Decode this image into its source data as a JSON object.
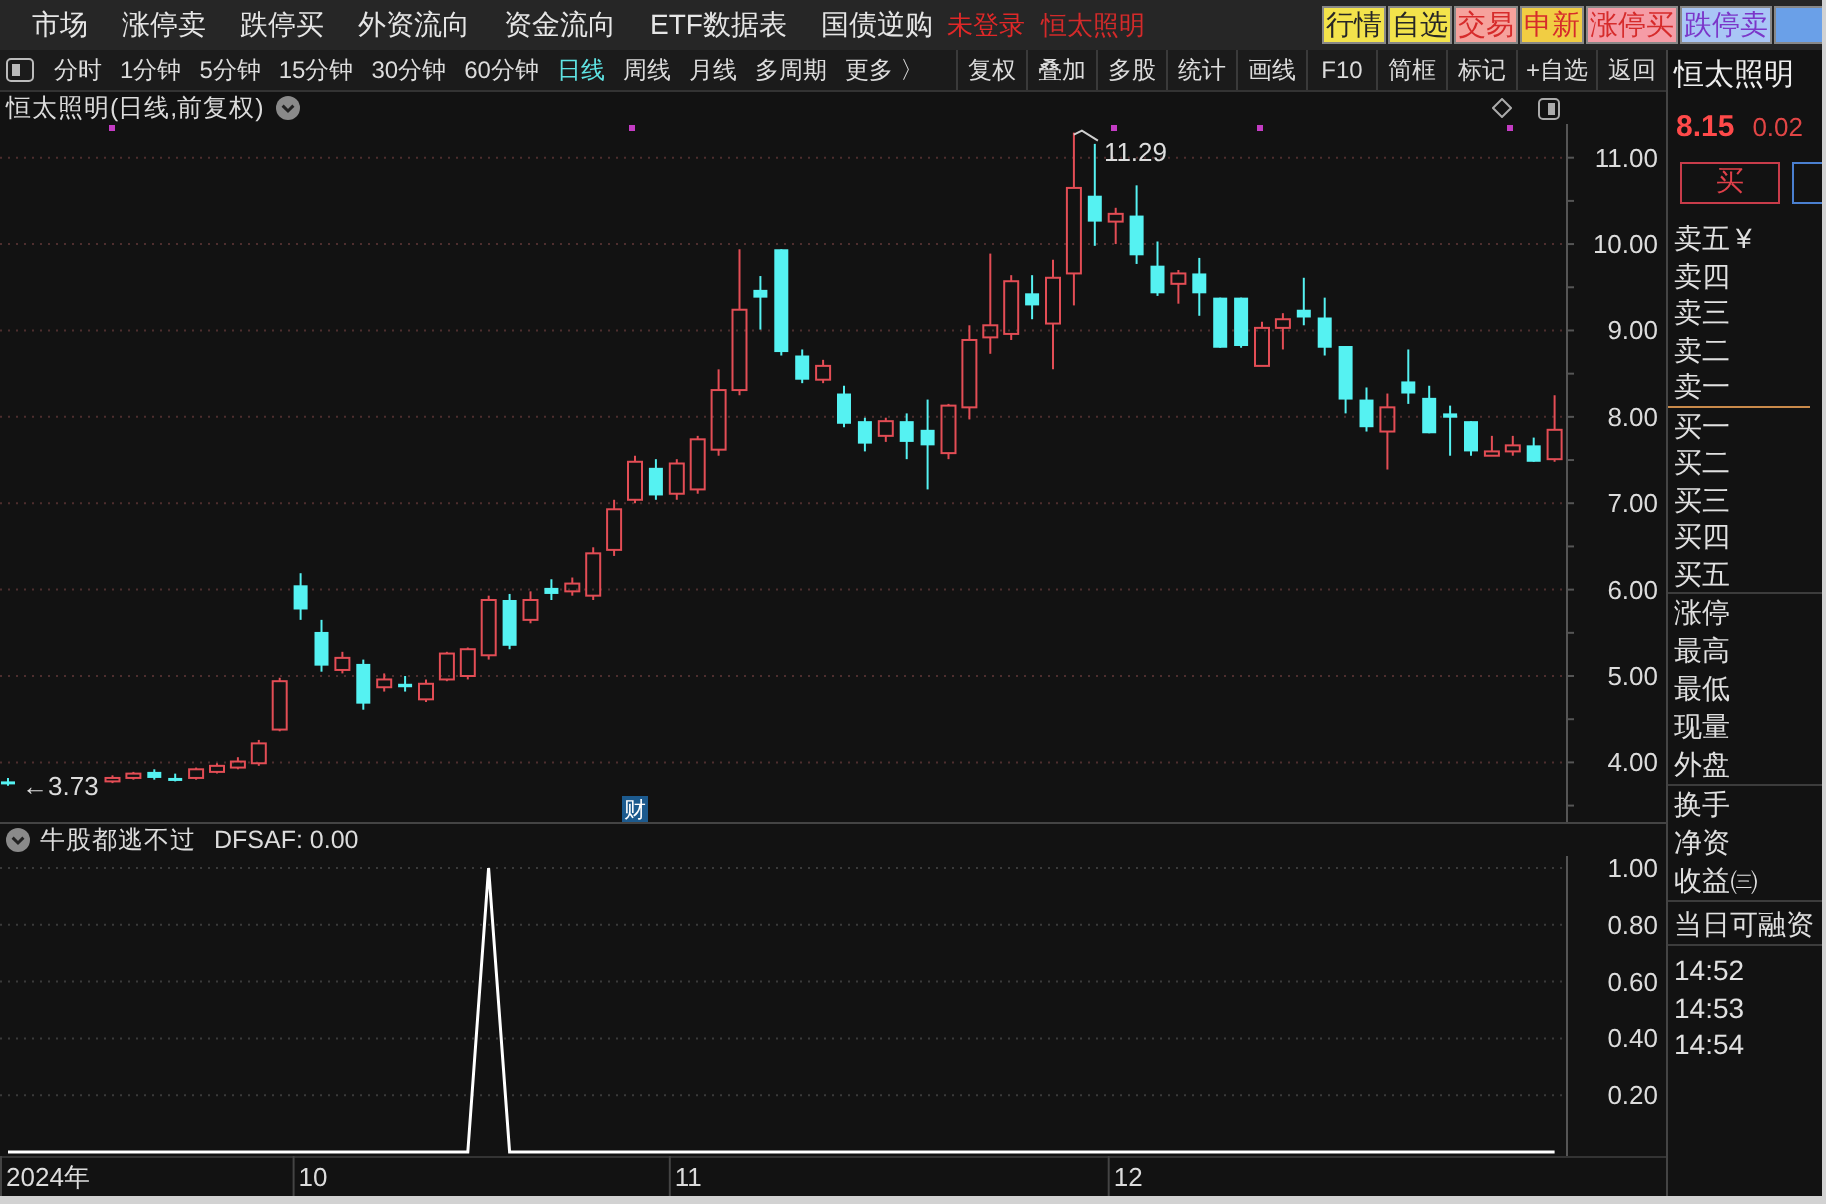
{
  "menu": [
    "市场",
    "涨停卖",
    "跌停买",
    "外资流向",
    "资金流向",
    "ETF数据表",
    "国债逆购"
  ],
  "login_status": "未登录",
  "current_stock": "恒太照明",
  "quick_buttons": [
    {
      "label": "行情",
      "color": "#f3e34b",
      "kind": "quote"
    },
    {
      "label": "自选",
      "color": "#f3e34b",
      "kind": "quote"
    },
    {
      "label": "交易",
      "color": "#f6a29c",
      "kind": "trade"
    },
    {
      "label": "申新",
      "color": "#f1cd43",
      "kind": "trade"
    },
    {
      "label": "涨停买",
      "color": "#f59ca6",
      "kind": "trade"
    },
    {
      "label": "跌停卖",
      "color": "#a9c6f6",
      "kind": "fall"
    },
    {
      "color": "#6aa0e8"
    }
  ],
  "periods": [
    {
      "label": "分时",
      "selected": false
    },
    {
      "label": "1分钟",
      "selected": false
    },
    {
      "label": "5分钟",
      "selected": false
    },
    {
      "label": "15分钟",
      "selected": false
    },
    {
      "label": "30分钟",
      "selected": false
    },
    {
      "label": "60分钟",
      "selected": false
    },
    {
      "label": "日线",
      "selected": true
    },
    {
      "label": "周线",
      "selected": false
    },
    {
      "label": "月线",
      "selected": false
    },
    {
      "label": "多周期",
      "selected": false
    },
    {
      "label": "更多 〉",
      "selected": false
    }
  ],
  "tools": [
    "复权",
    "叠加",
    "多股",
    "统计",
    "画线",
    "F10",
    "简框",
    "标记",
    "+自选",
    "返回"
  ],
  "chart": {
    "title": "恒太照明(日线,前复权)",
    "event_tag": "财",
    "high_label": "11.29",
    "low_label": "←3.73",
    "chart_data": {
      "type": "candlestick",
      "grid": true,
      "ylim": [
        3.31,
        11.39
      ],
      "categories": [
        null,
        null,
        null,
        null,
        null,
        null,
        null,
        null,
        null,
        null,
        null,
        null,
        null,
        null,
        null,
        null,
        null,
        null,
        null,
        null,
        null,
        null,
        null,
        null,
        null,
        null,
        null,
        null,
        null,
        null,
        null,
        null,
        null,
        null,
        null,
        null,
        null,
        null,
        null,
        null,
        null,
        null,
        null,
        null,
        null,
        null,
        null,
        null,
        null,
        null,
        null,
        null,
        null,
        null,
        null,
        null,
        null,
        null,
        null,
        null,
        null,
        null,
        null,
        null,
        null,
        null,
        null,
        null,
        null,
        null,
        null,
        null,
        null,
        null,
        null
      ],
      "ohlc": [
        [
          3.78,
          3.82,
          3.73,
          3.75
        ],
        null,
        null,
        null,
        null,
        [
          3.78,
          3.85,
          3.76,
          3.82
        ],
        [
          3.82,
          3.89,
          3.8,
          3.87
        ],
        [
          3.89,
          3.92,
          3.8,
          3.82
        ],
        [
          3.82,
          3.87,
          3.78,
          3.8
        ],
        [
          3.82,
          3.94,
          3.8,
          3.92
        ],
        [
          3.89,
          3.99,
          3.87,
          3.96
        ],
        [
          3.94,
          4.06,
          3.92,
          4.01
        ],
        [
          3.99,
          4.26,
          3.96,
          4.22
        ],
        [
          4.38,
          4.98,
          4.36,
          4.94
        ],
        [
          6.05,
          6.19,
          5.65,
          5.77
        ],
        [
          5.51,
          5.65,
          5.05,
          5.12
        ],
        [
          5.07,
          5.28,
          5.03,
          5.21
        ],
        [
          5.14,
          5.19,
          4.61,
          4.68
        ],
        [
          4.87,
          5.03,
          4.82,
          4.96
        ],
        [
          4.91,
          5.0,
          4.82,
          4.87
        ],
        [
          4.73,
          4.96,
          4.7,
          4.91
        ],
        [
          4.96,
          5.28,
          4.94,
          5.26
        ],
        [
          5.0,
          5.33,
          4.96,
          5.31
        ],
        [
          5.24,
          5.93,
          5.19,
          5.88
        ],
        [
          5.88,
          5.95,
          5.31,
          5.35
        ],
        [
          5.65,
          5.98,
          5.61,
          5.88
        ],
        [
          6.02,
          6.12,
          5.88,
          5.95
        ],
        [
          5.98,
          6.14,
          5.93,
          6.07
        ],
        [
          5.93,
          6.49,
          5.88,
          6.42
        ],
        [
          6.46,
          7.04,
          6.39,
          6.93
        ],
        [
          7.04,
          7.55,
          7.0,
          7.48
        ],
        [
          7.41,
          7.51,
          7.04,
          7.09
        ],
        [
          7.11,
          7.51,
          7.04,
          7.46
        ],
        [
          7.16,
          7.78,
          7.11,
          7.74
        ],
        [
          7.62,
          8.55,
          7.55,
          8.31
        ],
        [
          8.31,
          9.94,
          8.25,
          9.24
        ],
        [
          9.47,
          9.63,
          9.01,
          9.38
        ],
        [
          9.94,
          9.94,
          8.71,
          8.75
        ],
        [
          8.71,
          8.78,
          8.39,
          8.43
        ],
        [
          8.43,
          8.66,
          8.39,
          8.59
        ],
        [
          8.27,
          8.36,
          7.88,
          7.92
        ],
        [
          7.95,
          7.99,
          7.6,
          7.69
        ],
        [
          7.78,
          7.99,
          7.71,
          7.95
        ],
        [
          7.95,
          8.04,
          7.51,
          7.71
        ],
        [
          7.85,
          8.2,
          7.16,
          7.67
        ],
        [
          7.58,
          8.15,
          7.51,
          8.13
        ],
        [
          8.11,
          9.06,
          7.97,
          8.89
        ],
        [
          8.92,
          9.89,
          8.73,
          9.06
        ],
        [
          8.96,
          9.64,
          8.89,
          9.57
        ],
        [
          9.43,
          9.64,
          9.13,
          9.29
        ],
        [
          9.08,
          9.82,
          8.55,
          9.61
        ],
        [
          9.66,
          11.29,
          9.29,
          10.65
        ],
        [
          10.56,
          11.16,
          9.98,
          10.26
        ],
        [
          10.26,
          10.42,
          10.0,
          10.35
        ],
        [
          10.33,
          10.68,
          9.77,
          9.87
        ],
        [
          9.75,
          10.03,
          9.4,
          9.43
        ],
        [
          9.54,
          9.7,
          9.31,
          9.66
        ],
        [
          9.66,
          9.84,
          9.17,
          9.43
        ],
        [
          9.38,
          9.38,
          8.8,
          8.8
        ],
        [
          9.38,
          9.38,
          8.8,
          8.82
        ],
        [
          8.59,
          9.1,
          8.59,
          9.03
        ],
        [
          9.03,
          9.2,
          8.78,
          9.13
        ],
        [
          9.24,
          9.61,
          9.06,
          9.15
        ],
        [
          9.15,
          9.38,
          8.71,
          8.8
        ],
        [
          8.82,
          8.82,
          8.04,
          8.2
        ],
        [
          8.2,
          8.34,
          7.83,
          7.88
        ],
        [
          7.83,
          8.27,
          7.39,
          8.11
        ],
        [
          8.41,
          8.78,
          8.15,
          8.27
        ],
        [
          8.22,
          8.36,
          7.81,
          7.81
        ],
        [
          8.04,
          8.13,
          7.55,
          7.99
        ],
        [
          7.95,
          7.95,
          7.55,
          7.6
        ],
        [
          7.55,
          7.78,
          7.55,
          7.6
        ],
        [
          7.6,
          7.78,
          7.55,
          7.67
        ],
        [
          7.67,
          7.76,
          7.48,
          7.48
        ],
        [
          7.51,
          8.25,
          7.48,
          7.85
        ]
      ],
      "yticks": [
        {
          "value": 11,
          "label": "11.00"
        },
        {
          "value": 10,
          "label": "10.00"
        },
        {
          "value": 9,
          "label": "9.00"
        },
        {
          "value": 8,
          "label": "8.00"
        },
        {
          "value": 7,
          "label": "7.00"
        },
        {
          "value": 6,
          "label": "6.00"
        },
        {
          "value": 5,
          "label": "5.00"
        },
        {
          "value": 4,
          "label": "4.00"
        }
      ]
    }
  },
  "indicator": {
    "name": "牛股都逃不过",
    "reading": "DFSAF: 0.00",
    "chart_data": {
      "type": "line",
      "grid": true,
      "ylim": [
        0,
        1
      ],
      "yticks": [
        {
          "value": 1,
          "label": "1.00"
        },
        {
          "value": 0.8,
          "label": "0.80"
        },
        {
          "value": 0.6,
          "label": "0.60"
        },
        {
          "value": 0.4,
          "label": "0.40"
        },
        {
          "value": 0.2,
          "label": "0.20"
        }
      ],
      "series": [
        {
          "color": "#ffffff",
          "values": [
            0,
            0,
            0,
            0,
            0,
            0,
            0,
            0,
            0,
            0,
            0,
            0,
            0,
            0,
            0,
            0,
            0,
            0,
            0,
            0,
            0,
            0,
            0,
            1,
            0,
            0,
            0,
            0,
            0,
            0,
            0,
            0,
            0,
            0,
            0,
            0,
            0,
            0,
            0,
            0,
            0,
            0,
            0,
            0,
            0,
            0,
            0,
            0,
            0,
            0,
            0,
            0,
            0,
            0,
            0,
            0,
            0,
            0,
            0,
            0,
            0,
            0,
            0,
            0,
            0,
            0,
            0,
            0,
            0,
            0,
            0,
            0,
            0,
            0,
            0
          ]
        }
      ]
    }
  },
  "x_axis": [
    "2024年",
    "10",
    "11",
    "12"
  ],
  "quote": {
    "name": "恒太照明",
    "price": "8.15",
    "change": "0.02",
    "buy_button": "买"
  },
  "order_book": {
    "asks": [
      "卖五",
      "卖四",
      "卖三",
      "卖二",
      "卖一"
    ],
    "currency": "¥",
    "bids": [
      "买一",
      "买二",
      "买三",
      "买四",
      "买五"
    ]
  },
  "stat_groups": [
    [
      "涨停",
      "最高",
      "最低",
      "现量",
      "外盘"
    ],
    [
      "换手",
      "净资",
      "收益㈢"
    ]
  ],
  "margin_label": "当日可融资",
  "times": [
    "14:52",
    "14:53",
    "14:54"
  ]
}
